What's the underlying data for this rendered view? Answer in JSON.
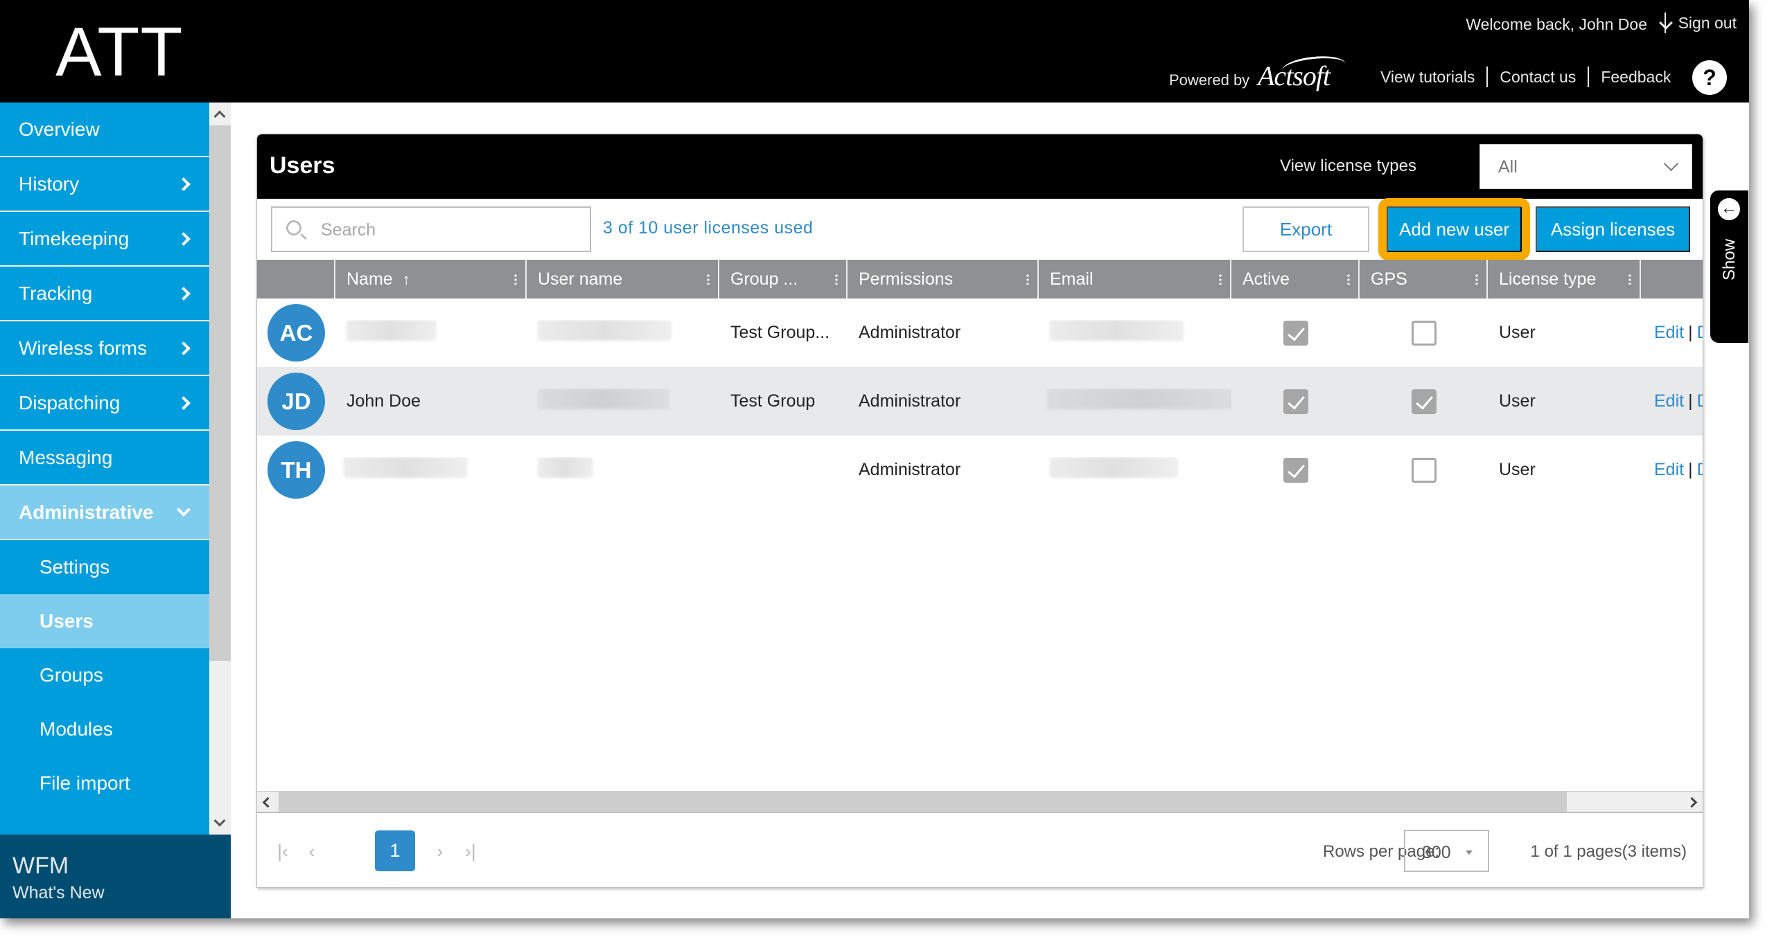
{
  "header": {
    "logo": "ATT",
    "welcome": "Welcome back, John Doe",
    "sign_out": "Sign out",
    "powered_by": "Powered by",
    "brand": "Actsoft",
    "links": [
      "View tutorials",
      "Contact us",
      "Feedback"
    ],
    "help_icon": "?"
  },
  "sidebar": {
    "items": [
      {
        "label": "Overview",
        "has_children": false
      },
      {
        "label": "History",
        "has_children": true
      },
      {
        "label": "Timekeeping",
        "has_children": true
      },
      {
        "label": "Tracking",
        "has_children": true
      },
      {
        "label": "Wireless forms",
        "has_children": true
      },
      {
        "label": "Dispatching",
        "has_children": true
      },
      {
        "label": "Messaging",
        "has_children": false
      },
      {
        "label": "Administrative",
        "has_children": true,
        "expanded": true
      }
    ],
    "sub_items": [
      {
        "label": "Settings"
      },
      {
        "label": "Users",
        "active": true
      },
      {
        "label": "Groups"
      },
      {
        "label": "Modules"
      },
      {
        "label": "File import"
      }
    ],
    "footer": {
      "title": "WFM",
      "subtitle": "What's New"
    }
  },
  "panel": {
    "title": "Users",
    "license_types_label": "View license types",
    "license_types_value": "All",
    "search_placeholder": "Search",
    "licenses_used": "3 of 10 user licenses used",
    "buttons": {
      "export": "Export",
      "add_new_user": "Add new user",
      "assign_licenses": "Assign licenses"
    },
    "columns": [
      "",
      "Name",
      "User name",
      "Group ...",
      "Permissions",
      "Email",
      "Active",
      "GPS",
      "License type",
      ""
    ],
    "sort": {
      "column": "Name",
      "direction": "ascending",
      "icon": "↑"
    },
    "rows": [
      {
        "initials": "AC",
        "name": "",
        "username": "",
        "group": "Test Group...",
        "permissions": "Administrator",
        "email": "",
        "active": true,
        "gps": false,
        "license_type": "User",
        "actions": [
          "Edit",
          "D"
        ]
      },
      {
        "initials": "JD",
        "name": "John Doe",
        "username": "",
        "group": "Test Group",
        "permissions": "Administrator",
        "email": "",
        "active": true,
        "gps": true,
        "license_type": "User",
        "actions": [
          "Edit",
          "D"
        ]
      },
      {
        "initials": "TH",
        "name": "",
        "username": "",
        "group": "",
        "permissions": "Administrator",
        "email": "",
        "active": true,
        "gps": false,
        "license_type": "User",
        "actions": [
          "Edit",
          "D"
        ]
      }
    ],
    "pagination": {
      "first": "|‹",
      "prev": "‹",
      "current_page": "1",
      "next": "›",
      "last": "›|",
      "rows_per_page_label": "Rows per page:",
      "rows_per_page": "300",
      "info": "1 of 1 pages(3 items)"
    }
  },
  "show_tab": {
    "label": "Show",
    "icon": "←"
  },
  "colors": {
    "primary": "#009ddc",
    "highlight": "#7fcdee",
    "link": "#2f8bc9",
    "focus_outline": "#f6aa00",
    "footer": "#004d71"
  }
}
